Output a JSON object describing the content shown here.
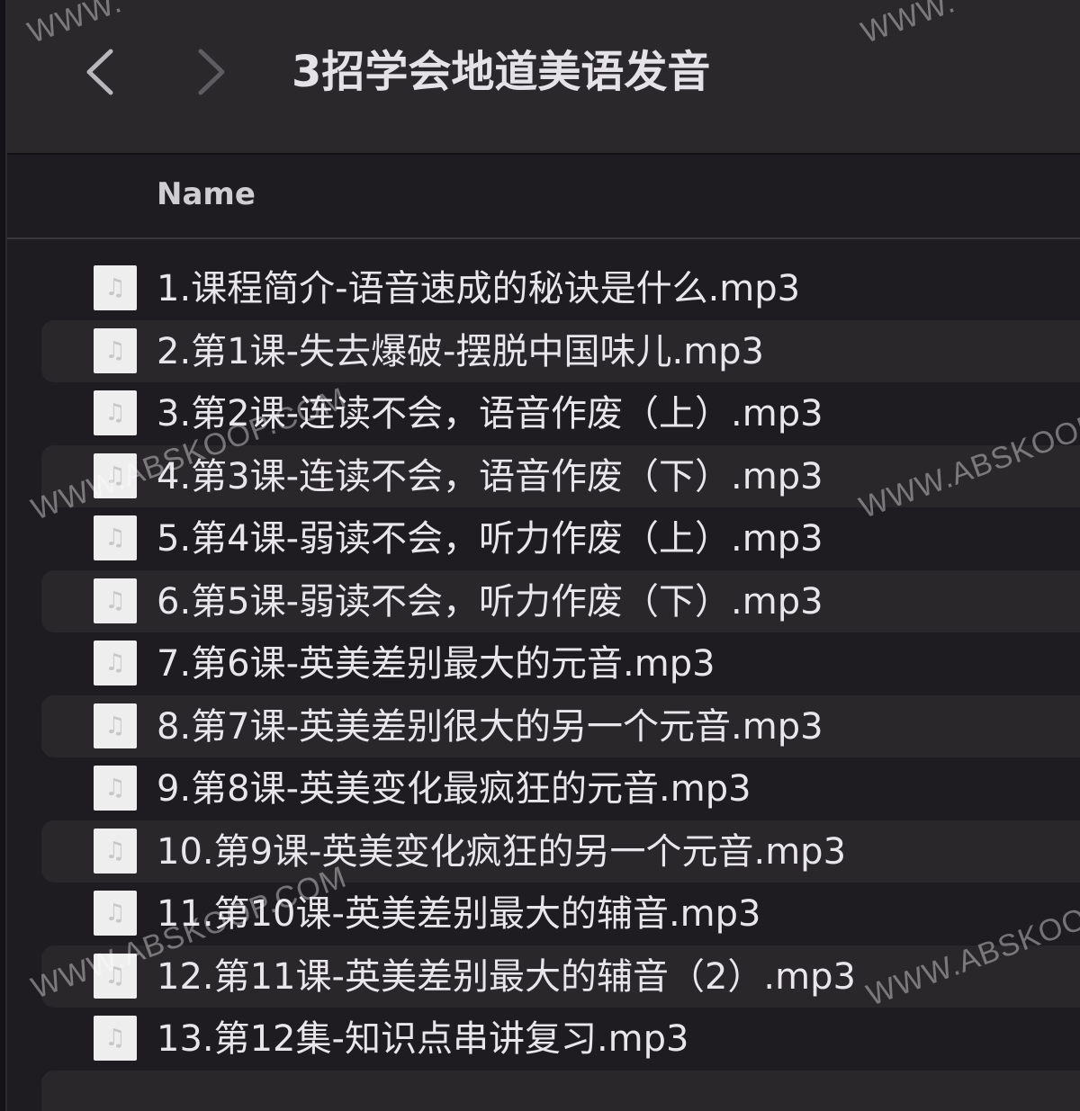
{
  "window": {
    "title": "3招学会地道美语发音"
  },
  "nav": {
    "back_icon": "chevron-left-icon",
    "forward_icon": "chevron-right-icon"
  },
  "columns": {
    "name": "Name"
  },
  "files": [
    {
      "name": "1.课程简介-语音速成的秘诀是什么.mp3",
      "icon": "audio-file-icon"
    },
    {
      "name": "2.第1课-失去爆破-摆脱中国味儿.mp3",
      "icon": "audio-file-icon"
    },
    {
      "name": "3.第2课-连读不会，语音作废（上）.mp3",
      "icon": "audio-file-icon"
    },
    {
      "name": "4.第3课-连读不会，语音作废（下）.mp3",
      "icon": "audio-file-icon"
    },
    {
      "name": "5.第4课-弱读不会，听力作废（上）.mp3",
      "icon": "audio-file-icon"
    },
    {
      "name": "6.第5课-弱读不会，听力作废（下）.mp3",
      "icon": "audio-file-icon"
    },
    {
      "name": "7.第6课-英美差别最大的元音.mp3",
      "icon": "audio-file-icon"
    },
    {
      "name": "8.第7课-英美差别很大的另一个元音.mp3",
      "icon": "audio-file-icon"
    },
    {
      "name": "9.第8课-英美变化最疯狂的元音.mp3",
      "icon": "audio-file-icon"
    },
    {
      "name": "10.第9课-英美变化疯狂的另一个元音.mp3",
      "icon": "audio-file-icon"
    },
    {
      "name": "11.第10课-英美差别最大的辅音.mp3",
      "icon": "audio-file-icon"
    },
    {
      "name": "12.第11课-英美差别最大的辅音（2）.mp3",
      "icon": "audio-file-icon"
    },
    {
      "name": "13.第12集-知识点串讲复习.mp3",
      "icon": "audio-file-icon"
    }
  ],
  "watermarks": {
    "w1": "WWW.ABSKOOP.COM",
    "w2": "WWW.ABSKOOP.COM",
    "w3": "WWW.ABSKOOP.COM",
    "w4": "WWW.ABSKOOP.COM",
    "w5": "WWW.",
    "w6": "WWW."
  }
}
